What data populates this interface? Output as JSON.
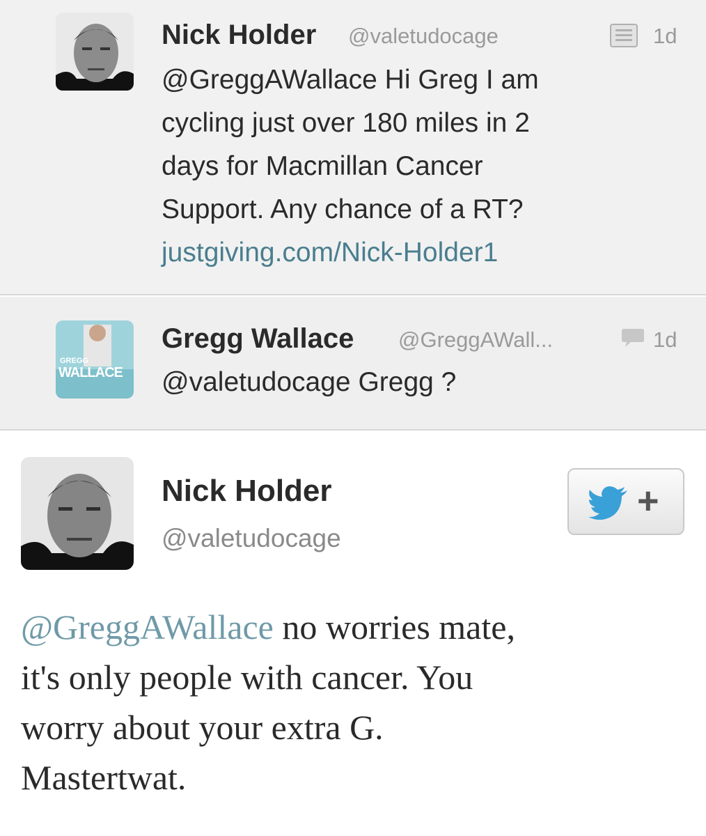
{
  "tweets": [
    {
      "name": "Nick Holder",
      "handle": "@valetudocage",
      "time": "1d",
      "mention": "@GreggAWallace",
      "text_lines": [
        "Hi Greg I am",
        "cycling just over 180 miles in 2",
        "days for Macmillan Cancer",
        "Support.  Any chance of a RT?"
      ],
      "link": "justgiving.com/Nick-Holder1",
      "icon": "conversation-icon"
    },
    {
      "name": "Gregg Wallace",
      "handle": "@GreggAWall...",
      "time": "1d",
      "text": "@valetudocage Gregg ?",
      "icon": "reply-bubble-icon",
      "avatar_text": [
        "GREGG",
        "WALLACE"
      ]
    }
  ],
  "expanded": {
    "name": "Nick Holder",
    "handle": "@valetudocage",
    "follow_icon": "twitter-bird-plus-icon",
    "follow_plus": "+",
    "mention": "@GreggAWallace",
    "text_lines": [
      " no worries mate,",
      "it's only people with cancer. You",
      "worry about your extra G.",
      "Mastertwat."
    ]
  },
  "colors": {
    "link": "#4a7e8e",
    "mention": "#6f9aa8",
    "twitter_blue": "#3aa0d8",
    "background_compact": "#f1f1f1"
  }
}
